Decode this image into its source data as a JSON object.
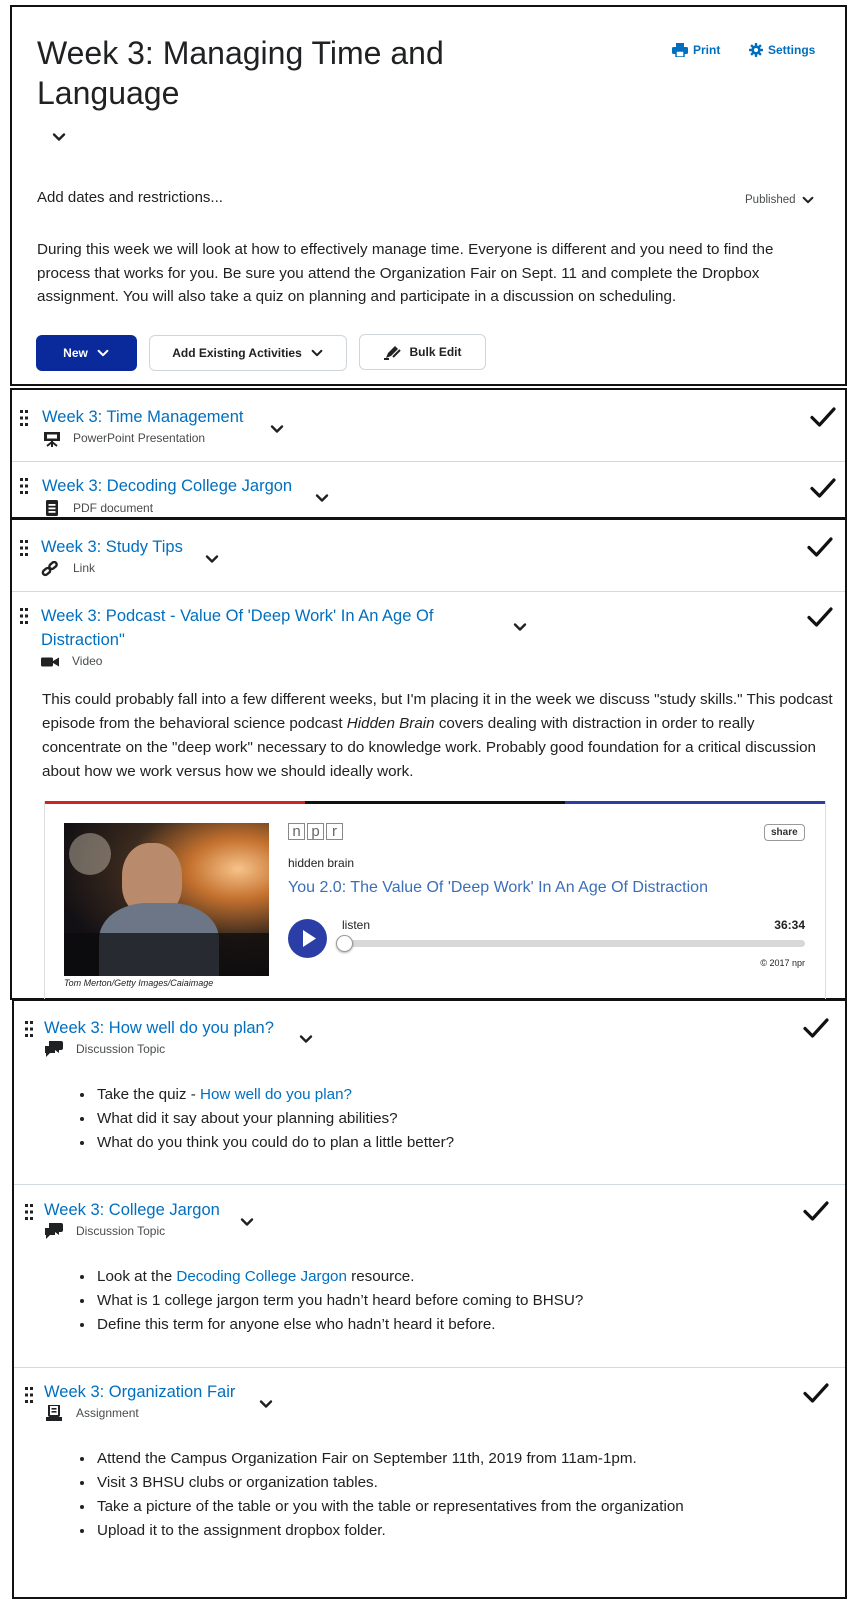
{
  "header": {
    "title": "Week 3: Managing Time and Language",
    "print_label": "Print",
    "settings_label": "Settings",
    "dates_label": "Add dates and restrictions...",
    "status_label": "Published",
    "description": "During this week we will look at how to effectively manage time.  Everyone is different and you need to find the process that works for you.  Be sure you attend the Organization Fair on Sept. 11 and complete the Dropbox assignment.  You will also take a quiz on planning and participate in a discussion on scheduling.",
    "new_label": "New",
    "add_existing_label": "Add Existing Activities",
    "bulk_edit_label": "Bulk Edit"
  },
  "items": [
    {
      "title": "Week 3: Time Management",
      "type": "PowerPoint Presentation",
      "icon": "presentation-icon"
    },
    {
      "title": "Week 3: Decoding College Jargon",
      "type": "PDF document",
      "icon": "document-icon"
    },
    {
      "title": "Week 3: Study Tips",
      "type": "Link",
      "icon": "link-icon"
    },
    {
      "title": "Week 3: Podcast - Value Of 'Deep Work' In An Age Of Distraction\"",
      "type": "Video",
      "icon": "video-icon"
    },
    {
      "title": "Week 3: How well do you plan?",
      "type": "Discussion Topic",
      "icon": "discussion-icon"
    },
    {
      "title": "Week 3: College Jargon",
      "type": "Discussion Topic",
      "icon": "discussion-icon"
    },
    {
      "title": "Week 3: Organization Fair",
      "type": "Assignment",
      "icon": "assignment-icon"
    }
  ],
  "podcast": {
    "desc_1": "This could probably fall into a few different weeks, but I'm placing it in the week we discuss \"study skills.\"  This podcast episode from the behavioral science podcast ",
    "desc_show": "Hidden Brain",
    "desc_2": " covers dealing with distraction in order to really concentrate on the \"deep work\" necessary to do knowledge work.  Probably good foundation for a critical discussion about how we work versus how we should ideally work.",
    "logo": [
      "n",
      "p",
      "r"
    ],
    "share_label": "share",
    "show": "hidden brain",
    "episode": "You 2.0: The Value Of 'Deep Work' In An Age Of Distraction",
    "listen_label": "listen",
    "duration": "36:34",
    "copyright": "© 2017 npr",
    "credit": "Tom Merton/Getty Images/Caiaimage",
    "progress": 0
  },
  "plan": {
    "b1_prefix": "Take the quiz - ",
    "b1_link": "How well do you plan?",
    "b2": "What did it say about your planning abilities?",
    "b3": "What do you think you could do to plan a little better?"
  },
  "jargon": {
    "b1_prefix": "Look at the ",
    "b1_link": "Decoding College Jargon",
    "b1_suffix": " resource.",
    "b2": "What is 1 college jargon term you hadn’t heard before coming to BHSU?",
    "b3": "Define this term for anyone else who hadn’t heard it before."
  },
  "fair": {
    "b1": "Attend the Campus Organization Fair on September 11th, 2019 from 11am-1pm.",
    "b2": "Visit 3 BHSU clubs or organization tables.",
    "b3": "Take a picture of the table or you with the table or representatives from the organization",
    "b4": "Upload it to the assignment dropbox folder."
  },
  "colors": {
    "link": "#006fbf",
    "primary": "#0a2a9c",
    "npr_red": "#d62021",
    "npr_blue": "#2a3ea6"
  }
}
